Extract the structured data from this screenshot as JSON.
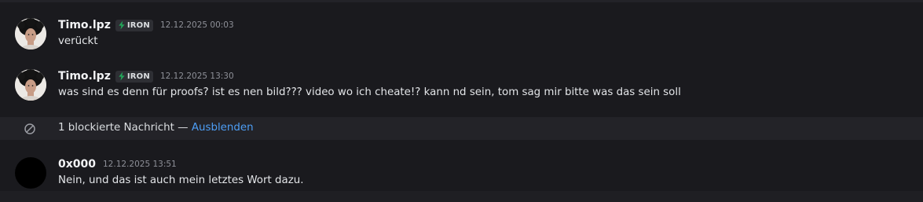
{
  "messages": [
    {
      "username": "Timo.lpz",
      "tag": "IRON",
      "timestamp": "12.12.2025 00:03",
      "text": "verückt"
    },
    {
      "username": "Timo.lpz",
      "tag": "IRON",
      "timestamp": "12.12.2025 13:30",
      "text": "was sind es denn für proofs? ist es nen bild??? video wo ich cheate!? kann nd sein, tom sag mir bitte was das sein soll"
    },
    {
      "username": "0x000",
      "timestamp": "12.12.2025 13:51",
      "text": "Nein, und das ist auch mein letztes Wort dazu."
    }
  ],
  "blocked": {
    "text": "1 blockierte Nachricht",
    "separator": " — ",
    "action_label": "Ausblenden"
  },
  "colors": {
    "background": "#1a1a1e",
    "link": "#4d9ef5",
    "tag_bolt": "#23a55a"
  },
  "icons": {
    "tag": "lightning-bolt-icon",
    "blocked": "blocked-circle-icon"
  }
}
